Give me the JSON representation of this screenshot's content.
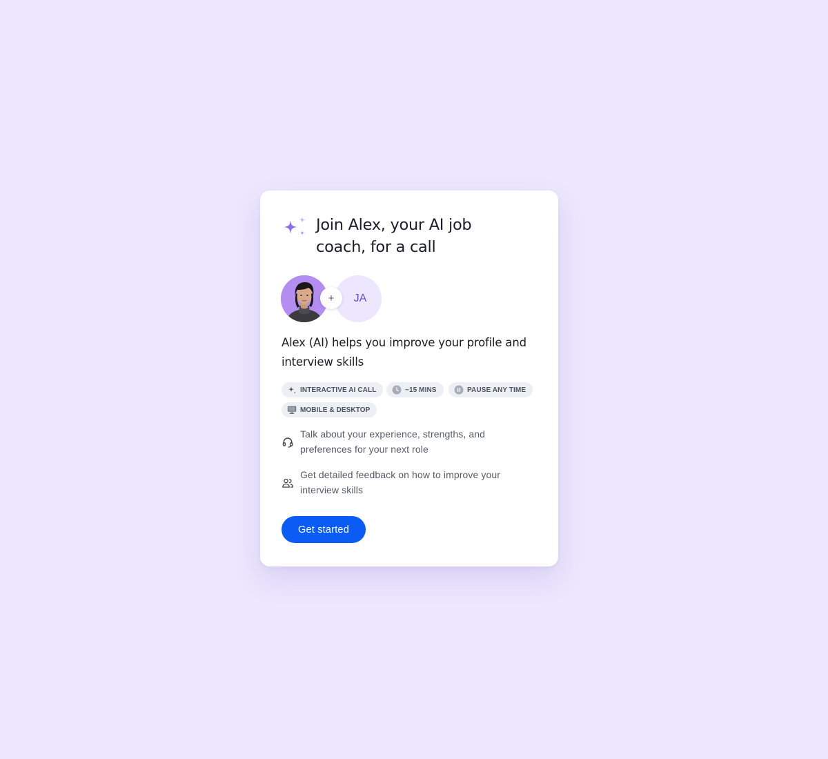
{
  "card": {
    "title": "Join Alex, your AI job coach, for a call",
    "subtitle": "Alex (AI) helps you improve your profile and interview skills",
    "avatars": {
      "user_initials": "JA",
      "plus_symbol": "+",
      "photo_icon": "coach-avatar-photo",
      "accent_color": "#b38ef0",
      "user_bg_color": "#ece7fe"
    },
    "tags": [
      {
        "label": "INTERACTIVE AI CALL",
        "icon": "sparkle-icon"
      },
      {
        "label": "~15 MINS",
        "icon": "clock-icon"
      },
      {
        "label": "PAUSE ANY TIME",
        "icon": "pause-icon"
      },
      {
        "label": "MOBILE & DESKTOP",
        "icon": "monitor-icon"
      }
    ],
    "features": [
      {
        "text": "Talk about your experience, strengths, and preferences for your next role",
        "icon": "headset-icon"
      },
      {
        "text": "Get detailed feedback on how to improve your interview skills",
        "icon": "users-icon"
      }
    ],
    "cta": {
      "label": "Get started",
      "color": "#0b5cf5"
    }
  },
  "colors": {
    "page_background": "#ece7fe",
    "card_background": "#ffffff",
    "sparkle": "#8b6cf0",
    "tag_background": "#eceff4"
  }
}
